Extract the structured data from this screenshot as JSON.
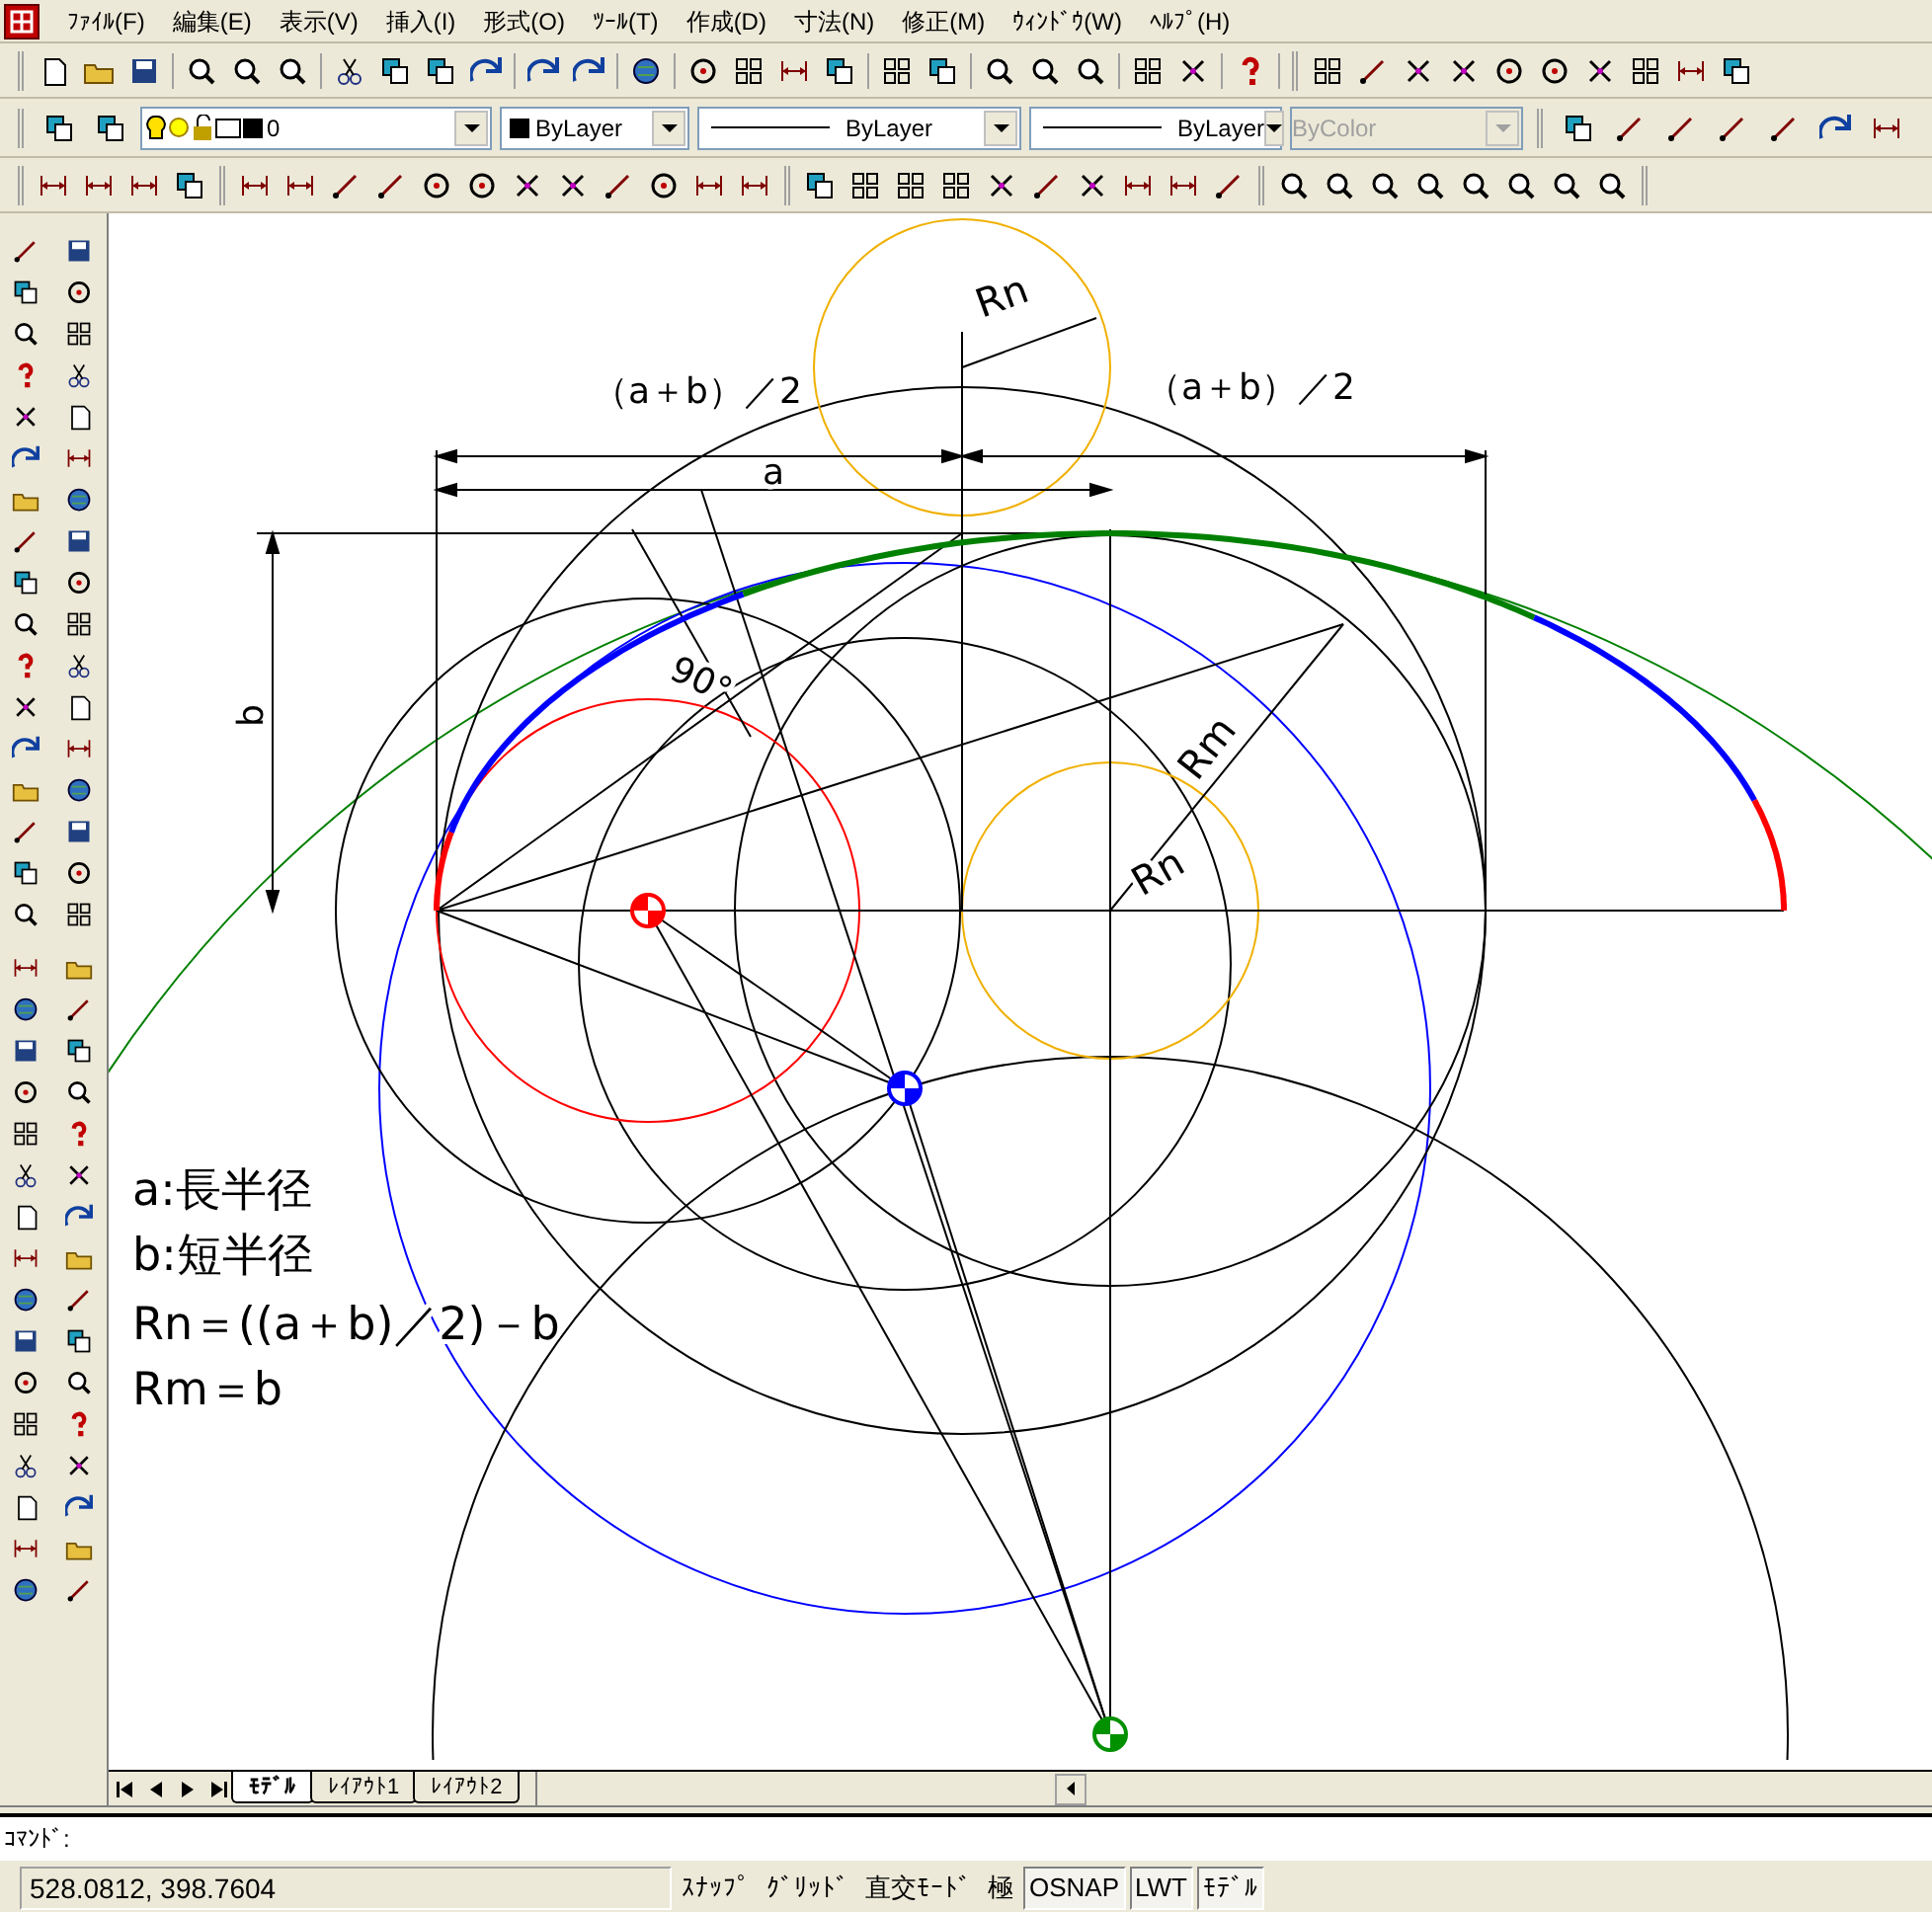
{
  "menu": [
    "ﾌｧｲﾙ(F)",
    "編集(E)",
    "表示(V)",
    "挿入(I)",
    "形式(O)",
    "ﾂｰﾙ(T)",
    "作成(D)",
    "寸法(N)",
    "修正(M)",
    "ｳｨﾝﾄﾞｳ(W)",
    "ﾍﾙﾌﾟ(H)"
  ],
  "properties": {
    "layer": "0",
    "object_color": "ByLayer",
    "linetype": "ByLayer",
    "lineweight": "ByLayer",
    "plotstyle": {
      "value": "ByColor",
      "disabled": true
    }
  },
  "drawing": {
    "dimension_labels": [
      "（a＋b）／2",
      "（a＋b）／2",
      "a",
      "b",
      "90°"
    ],
    "radius_labels": [
      "Rn",
      "Rm",
      "Rn"
    ],
    "legend": [
      "a:長半径",
      "b:短半径",
      "Rn＝((a＋b)／2)－b",
      "Rm＝b"
    ]
  },
  "tabs": [
    {
      "label": "ﾓﾃﾞﾙ",
      "selected": true
    },
    {
      "label": "ﾚｲｱｳﾄ1",
      "selected": false
    },
    {
      "label": "ﾚｲｱｳﾄ2",
      "selected": false
    }
  ],
  "command": {
    "prompt": "ｺﾏﾝﾄﾞ:"
  },
  "status_bar": {
    "coordinates": "528.0812, 398.7604",
    "toggles": [
      {
        "label": "ｽﾅｯﾌﾟ",
        "on": false
      },
      {
        "label": "ｸﾞﾘｯﾄﾞ",
        "on": false
      },
      {
        "label": "直交ﾓｰﾄﾞ",
        "on": false
      },
      {
        "label": "極",
        "on": false
      },
      {
        "label": "OSNAP",
        "on": true
      },
      {
        "label": "LWT",
        "on": true
      },
      {
        "label": "ﾓﾃﾞﾙ",
        "on": true
      }
    ]
  }
}
